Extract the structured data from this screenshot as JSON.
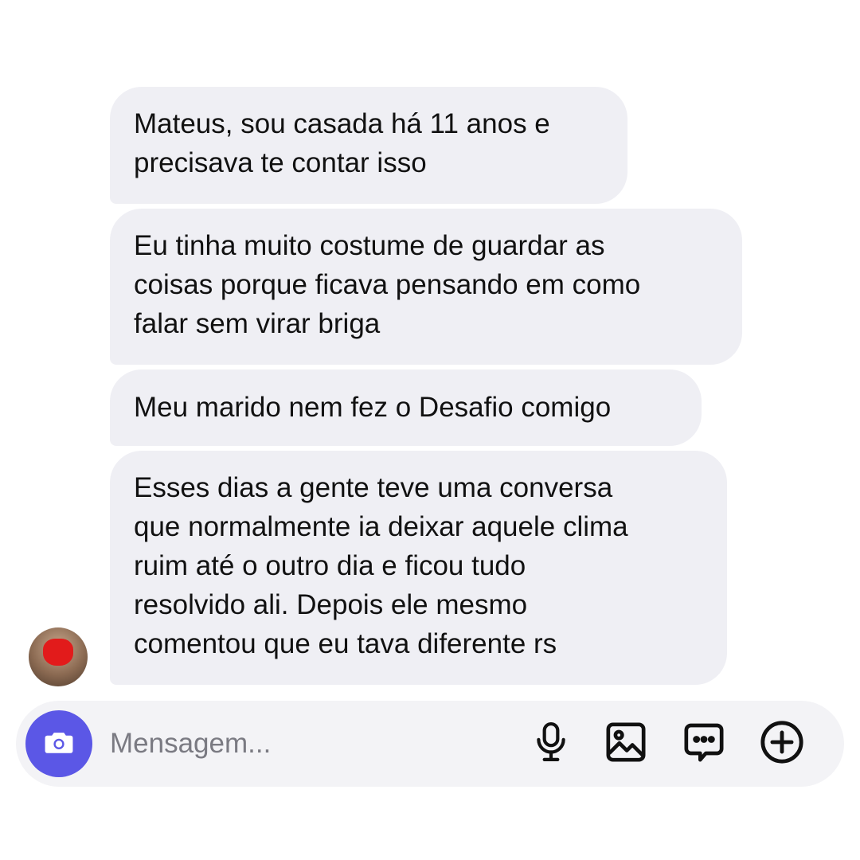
{
  "messages": [
    {
      "text": "Mateus, sou casada há 11 anos e\nprecisava te contar isso"
    },
    {
      "text": "Eu tinha muito costume de guardar as\ncoisas porque ficava pensando em como\nfalar sem virar briga"
    },
    {
      "text": "Meu marido nem fez o Desafio comigo"
    },
    {
      "text": "Esses dias a gente teve uma conversa\nque normalmente ia deixar aquele clima\nruim até o outro dia e ficou tudo\nresolvido ali. Depois ele mesmo\ncomentou que eu tava diferente rs"
    }
  ],
  "composer": {
    "placeholder": "Mensagem...",
    "icons": [
      "camera-icon",
      "microphone-icon",
      "image-icon",
      "chat-bubble-icon",
      "plus-circle-icon"
    ],
    "accent_color": "#5b57e6"
  },
  "colors": {
    "bubble": "#efeff4",
    "composer": "#f3f3f6",
    "text": "#111111",
    "placeholder": "#7a7a82",
    "redaction": "#e21b1b"
  }
}
